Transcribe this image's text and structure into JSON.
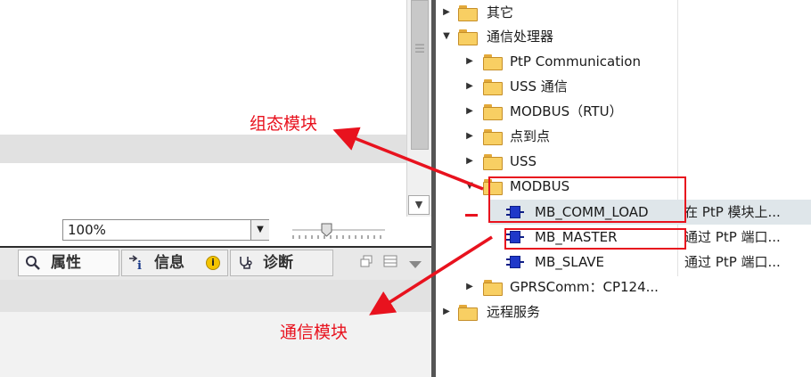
{
  "left": {
    "zoom_value": "100%",
    "tabs": [
      {
        "label": "属性",
        "icon": "properties-icon"
      },
      {
        "label": "信息",
        "icon": "info-list-icon",
        "badge": "i"
      },
      {
        "label": "诊断",
        "icon": "diagnostics-icon"
      }
    ],
    "window_icons": [
      "float-window-icon",
      "layout-icon",
      "collapse-arrow-icon"
    ]
  },
  "tree": {
    "items": [
      {
        "label": "其它",
        "type": "folder",
        "level": 0,
        "expanded": false
      },
      {
        "label": "通信处理器",
        "type": "folder",
        "level": 0,
        "expanded": true
      },
      {
        "label": "PtP Communication",
        "type": "folder",
        "level": 1,
        "expanded": false
      },
      {
        "label": "USS 通信",
        "type": "folder",
        "level": 1,
        "expanded": false
      },
      {
        "label": "MODBUS（RTU）",
        "type": "folder",
        "level": 1,
        "expanded": false
      },
      {
        "label": "点到点",
        "type": "folder",
        "level": 1,
        "expanded": false
      },
      {
        "label": "USS",
        "type": "folder",
        "level": 1,
        "expanded": false
      },
      {
        "label": "MODBUS",
        "type": "folder",
        "level": 1,
        "expanded": true
      },
      {
        "label": "MB_COMM_LOAD",
        "type": "block",
        "level": 2,
        "desc": "在 PtP 模块上..."
      },
      {
        "label": "MB_MASTER",
        "type": "block",
        "level": 2,
        "desc": "通过 PtP 端口..."
      },
      {
        "label": "MB_SLAVE",
        "type": "block",
        "level": 2,
        "desc": "通过 PtP 端口..."
      },
      {
        "label": "GPRSComm：CP124...",
        "type": "folder",
        "level": 1,
        "expanded": false
      },
      {
        "label": "远程服务",
        "type": "folder",
        "level": 0,
        "expanded": false
      }
    ]
  },
  "annotations": {
    "config_module": "组态模块",
    "comm_module": "通信模块"
  },
  "colors": {
    "annotation_red": "#e8121e",
    "folder_yellow": "#f8cf63",
    "block_blue": "#1f38c9",
    "selection": "#dfe6ea"
  }
}
